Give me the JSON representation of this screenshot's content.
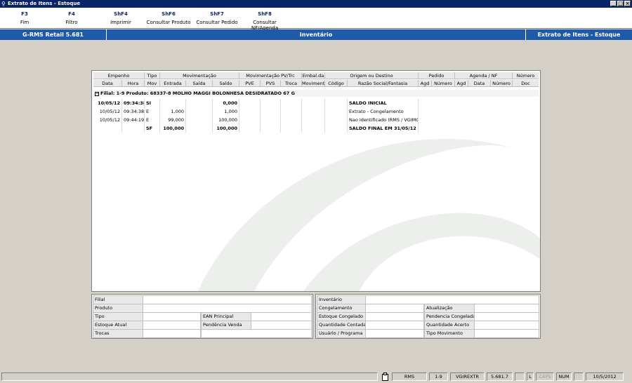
{
  "window": {
    "title": "Extrato de Itens - Estoque",
    "min": "_",
    "max": "□",
    "close": "×"
  },
  "fkeys": [
    {
      "key": "F3",
      "label": "Fim"
    },
    {
      "key": "F4",
      "label": "Filtro"
    },
    {
      "key": "ShF4",
      "label": "Imprimir"
    },
    {
      "key": "ShF6",
      "label": "Consultar Produto"
    },
    {
      "key": "ShF7",
      "label": "Consultar Pedido"
    },
    {
      "key": "ShF8",
      "label": "Consultar NF/Agenda"
    }
  ],
  "infobar": {
    "version": "G-RMS Retail 5.681",
    "module": "Inventário",
    "screen": "Extrato de Itens - Estoque"
  },
  "grid": {
    "group_headers": [
      "Empenho",
      "Tipo",
      "Movimentação",
      "Movimentação PV/Trc",
      "Embal.da",
      "Origem ou Destino",
      "Pedido",
      "Agenda / NF",
      "Número"
    ],
    "columns": [
      "Data",
      "Hora",
      "Mov",
      "Entrada",
      "Saída",
      "Saldo",
      "PVE",
      "PVS",
      "Troca",
      "Moviment",
      "Código",
      "Razão Social/Fantasia",
      "Agd",
      "Número",
      "Agd",
      "Data",
      "Número",
      "Doc"
    ],
    "group_row": "Filial: 1-9 Produto: 68337-8 MOLHO MAGGI BOLONHESA DESIDRATADO 67 G",
    "rows": [
      {
        "data": "10/05/12",
        "hora": "09:34:38",
        "mov": "SI",
        "entrada": "",
        "saida": "",
        "saldo": "0,000",
        "razao": "SALDO INICIAL",
        "bold": true
      },
      {
        "data": "10/05/12",
        "hora": "09:34:38",
        "mov": "E",
        "entrada": "1,000",
        "saida": "",
        "saldo": "1,000",
        "razao": "Extrato - Congelamento",
        "bold": false
      },
      {
        "data": "10/05/12",
        "hora": "09:44:19",
        "mov": "E",
        "entrada": "99,000",
        "saida": "",
        "saldo": "100,000",
        "razao": "Nao Identificado (RMS / VGIMCN",
        "bold": false
      },
      {
        "data": "",
        "hora": "",
        "mov": "SF",
        "entrada": "100,000",
        "saida": "",
        "saldo": "100,000",
        "razao": "SALDO FINAL EM 31/05/12",
        "bold": true
      }
    ]
  },
  "left_panel": {
    "filial": "Filial",
    "produto": "Produto",
    "tipo": "Tipo",
    "ean": "EAN Principal",
    "estoque_atual": "Estoque Atual",
    "pendencia_venda": "Pendência Venda",
    "trocas": "Trocas"
  },
  "right_panel": {
    "inventario": "Inventário",
    "congelamento": "Congelamento",
    "atualizacao": "Atualização",
    "estoque_congelado": "Estoque Congelado",
    "pendencia_congelada": "Pendencia Congelada",
    "quantidade_contada": "Quantidade Contada",
    "quantidade_acerto": "Quantidade Acerto",
    "usuario_programa": "Usuário / Programa",
    "tipo_movimento": "Tipo Movimento"
  },
  "status": {
    "app": "RMS",
    "filial": "1-9",
    "program": "VGIREXTR",
    "version": "5.681.7",
    "l": "L",
    "caps": "CAPS",
    "num": "NUM",
    "date": "10/5/2012"
  }
}
